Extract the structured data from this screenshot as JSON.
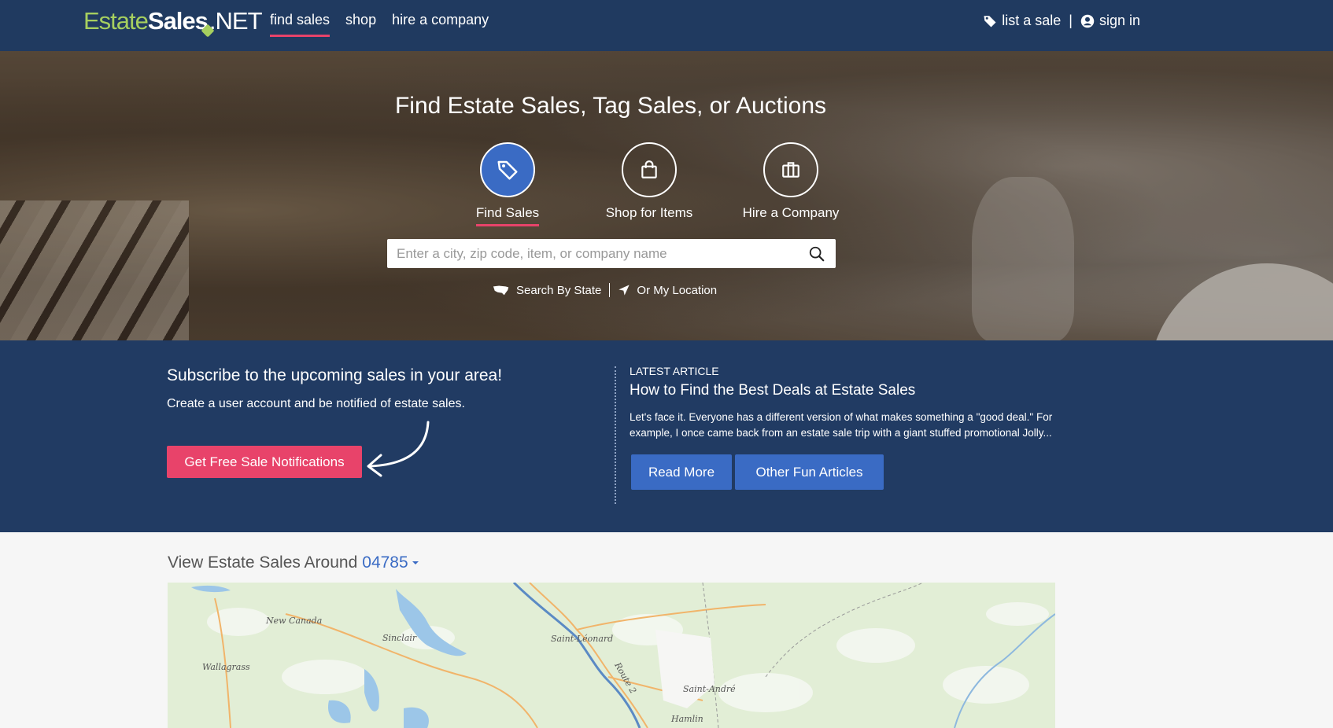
{
  "nav": {
    "logo": {
      "part1": "Estate",
      "part2": "Sales",
      "part3": ".NET"
    },
    "links": [
      "find sales",
      "shop",
      "hire a company"
    ],
    "active_link": "find sales",
    "list_sale": "list a sale",
    "separator": "|",
    "sign_in": "sign in"
  },
  "hero": {
    "title": "Find Estate Sales, Tag Sales, or Auctions",
    "tabs": [
      {
        "label": "Find Sales",
        "icon": "tag-icon",
        "active": true
      },
      {
        "label": "Shop for Items",
        "icon": "shopping-bag-icon",
        "active": false
      },
      {
        "label": "Hire a Company",
        "icon": "briefcase-icon",
        "active": false
      }
    ],
    "search_placeholder": "Enter a city, zip code, item, or company name",
    "search_by_state": "Search By State",
    "my_location": "Or My Location"
  },
  "subscribe": {
    "title": "Subscribe to the upcoming sales in your area!",
    "text": "Create a user account and be notified of estate sales.",
    "button": "Get Free Sale Notifications"
  },
  "article": {
    "kicker": "LATEST ARTICLE",
    "title": "How to Find the Best Deals at Estate Sales",
    "excerpt": "Let's face it. Everyone has a different version of what makes something a \"good deal.\" For example, I once came back from an estate sale trip with a giant stuffed promotional Jolly...",
    "read_more": "Read More",
    "other": "Other Fun Articles"
  },
  "map_section": {
    "heading": "View Estate Sales Around",
    "zip": "04785",
    "towns": [
      "New Canada",
      "Sinclair",
      "Wallagrass",
      "Saint-Léonard",
      "Route 2",
      "Saint-André",
      "Hamlin"
    ]
  },
  "colors": {
    "nav_bg": "#203a60",
    "band_bg": "#213b63",
    "accent_pink": "#e8436a",
    "accent_blue": "#3a6bc4",
    "logo_green": "#a6cf5f"
  }
}
